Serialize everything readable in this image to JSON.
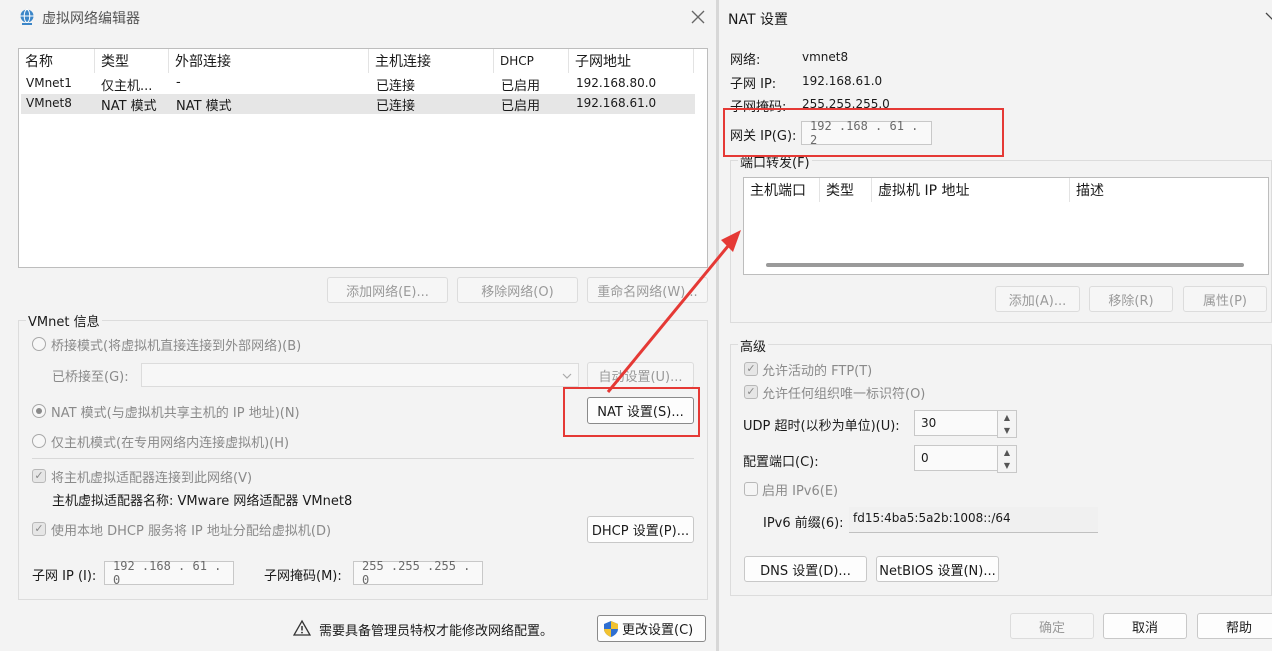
{
  "left": {
    "title": "虚拟网络编辑器",
    "columns": [
      "名称",
      "类型",
      "外部连接",
      "主机连接",
      "DHCP",
      "子网地址"
    ],
    "rows": [
      [
        "VMnet1",
        "仅主机...",
        "-",
        "已连接",
        "已启用",
        "192.168.80.0"
      ],
      [
        "VMnet8",
        "NAT 模式",
        "NAT 模式",
        "已连接",
        "已启用",
        "192.168.61.0"
      ]
    ],
    "buttons": {
      "add": "添加网络(E)...",
      "remove": "移除网络(O)",
      "rename": "重命名网络(W)..."
    },
    "vmnet_info": "VMnet 信息",
    "bridge_mode": "桥接模式(将虚拟机直接连接到外部网络)(B)",
    "bridged_to": "已桥接至(G):",
    "auto_settings": "自动设置(U)...",
    "nat_mode": "NAT 模式(与虚拟机共享主机的 IP 地址)(N)",
    "nat_settings": "NAT 设置(S)...",
    "host_only": "仅主机模式(在专用网络内连接虚拟机)(H)",
    "connect_adapter": "将主机虚拟适配器连接到此网络(V)",
    "adapter_name": "主机虚拟适配器名称: VMware 网络适配器 VMnet8",
    "use_dhcp": "使用本地 DHCP 服务将 IP 地址分配给虚拟机(D)",
    "dhcp_settings": "DHCP 设置(P)...",
    "subnet_ip_label": "子网 IP (I):",
    "subnet_ip": "192 .168 . 61 .  0",
    "subnet_mask_label": "子网掩码(M):",
    "subnet_mask": "255 .255 .255 .  0",
    "admin_note": "需要具备管理员特权才能修改网络配置。",
    "change_settings": "更改设置(C)"
  },
  "right": {
    "title": "NAT 设置",
    "network_label": "网络:",
    "network": "vmnet8",
    "subnet_ip_label": "子网 IP:",
    "subnet_ip": "192.168.61.0",
    "subnet_mask_label": "子网掩码:",
    "subnet_mask": "255.255.255.0",
    "gateway_label": "网关 IP(G):",
    "gateway": "192 .168 . 61 .  2",
    "port_forward": "端口转发(F)",
    "pf_columns": [
      "主机端口",
      "类型",
      "虚拟机 IP 地址",
      "描述"
    ],
    "pf_buttons": {
      "add": "添加(A)...",
      "remove": "移除(R)",
      "props": "属性(P)"
    },
    "advanced": "高级",
    "allow_ftp": "允许活动的 FTP(T)",
    "allow_org": "允许任何组织唯一标识符(O)",
    "udp_label": "UDP 超时(以秒为单位)(U):",
    "udp_value": "30",
    "config_port_label": "配置端口(C):",
    "config_port_value": "0",
    "enable_ipv6": "启用 IPv6(E)",
    "ipv6_prefix_label": "IPv6 前缀(6):",
    "ipv6_prefix": "fd15:4ba5:5a2b:1008::/64",
    "dns_settings": "DNS 设置(D)...",
    "netbios_settings": "NetBIOS 设置(N)...",
    "ok": "确定",
    "cancel": "取消",
    "help": "帮助"
  },
  "colors": {
    "annotation": "#e53935",
    "window_bg": "#f3f3f3"
  }
}
